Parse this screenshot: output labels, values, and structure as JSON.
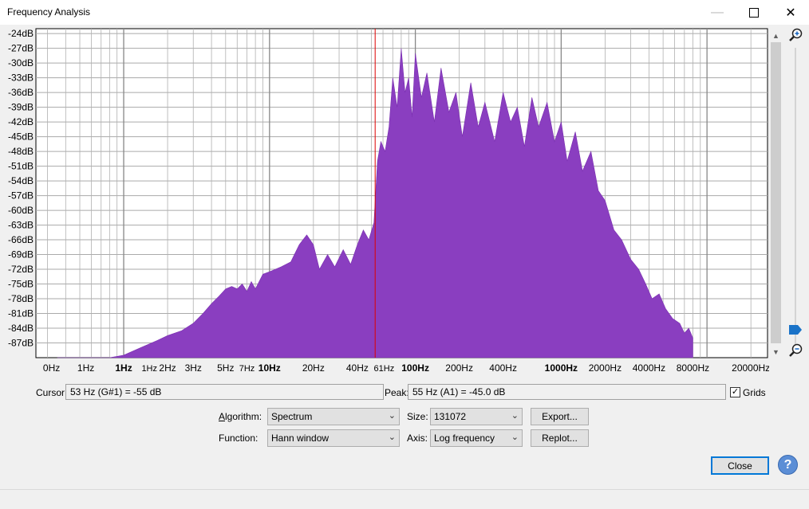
{
  "window": {
    "title": "Frequency Analysis",
    "controls": [
      "minimize-icon",
      "maximize-icon",
      "close-icon"
    ]
  },
  "chart_data": {
    "type": "area",
    "title": "",
    "xlabel": "",
    "ylabel": "",
    "x_scale": "log",
    "y_unit": "dB",
    "ylim": [
      -90,
      -23
    ],
    "grid": true,
    "colors": {
      "fill": "#8a3ec0",
      "grid": "#aaaaaa",
      "cursor_line": "#dd0000",
      "background": "#ffffff"
    },
    "y_ticks": [
      "-24dB",
      "-27dB",
      "-30dB",
      "-33dB",
      "-36dB",
      "-39dB",
      "-42dB",
      "-45dB",
      "-48dB",
      "-51dB",
      "-54dB",
      "-57dB",
      "-60dB",
      "-63dB",
      "-66dB",
      "-69dB",
      "-72dB",
      "-75dB",
      "-78dB",
      "-81dB",
      "-84dB",
      "-87dB"
    ],
    "x_ticks": [
      "0Hz",
      "1Hz",
      "1Hz",
      "1Hz",
      "2Hz",
      "3Hz",
      "5Hz",
      "7Hz",
      "10Hz",
      "20Hz",
      "40Hz",
      "61Hz",
      "100Hz",
      "200Hz",
      "400Hz",
      "1000Hz",
      "2000Hz",
      "4000Hz",
      "8000Hz",
      "20000Hz"
    ],
    "cursor_frequency_hz": 53,
    "series": [
      {
        "x": [
          0.35,
          0.45,
          0.6,
          0.8,
          1.0,
          1.3,
          1.7,
          2.0,
          2.5,
          3.0,
          3.5,
          4.0,
          4.5,
          5.0,
          5.5,
          6.0,
          6.5,
          7.0,
          7.5,
          8.0,
          9.0,
          10,
          12,
          14,
          16,
          18,
          20,
          22,
          25,
          28,
          32,
          36,
          40,
          44,
          48,
          52,
          55,
          58,
          62,
          66,
          70,
          75,
          80,
          85,
          90,
          95,
          100,
          110,
          120,
          135,
          150,
          170,
          190,
          210,
          240,
          270,
          300,
          350,
          400,
          450,
          500,
          560,
          630,
          700,
          800,
          900,
          1000,
          1100,
          1250,
          1400,
          1600,
          1800,
          2000,
          2300,
          2600,
          3000,
          3400,
          3800,
          4200,
          4700,
          5200,
          5800,
          6500,
          7000,
          7500,
          8000
        ],
        "y": [
          -90,
          -90,
          -90,
          -90,
          -89.5,
          -88,
          -86.5,
          -85.5,
          -84.5,
          -83,
          -81,
          -79,
          -77.5,
          -76,
          -75.5,
          -76,
          -75,
          -76.5,
          -74.5,
          -76,
          -73,
          -72.5,
          -71.5,
          -70.5,
          -67,
          -65,
          -67,
          -72,
          -69,
          -71.5,
          -68,
          -71,
          -67,
          -64,
          -66,
          -62.5,
          -50,
          -46,
          -48,
          -43,
          -33,
          -39,
          -27,
          -36,
          -33,
          -41,
          -28,
          -37,
          -32,
          -42,
          -31,
          -40,
          -36,
          -45,
          -34,
          -43,
          -38,
          -46,
          -36,
          -42,
          -39,
          -47,
          -37,
          -43,
          -38,
          -46,
          -42,
          -50,
          -44,
          -52,
          -48,
          -56,
          -58,
          -64,
          -66,
          -70,
          -72,
          -75,
          -78,
          -77,
          -80,
          -82,
          -83,
          -85,
          -84,
          -86
        ]
      }
    ]
  },
  "cursor": {
    "label": "Cursor:",
    "value": "53 Hz (G#1) = -55 dB"
  },
  "peak": {
    "label": "Peak:",
    "value": "55 Hz (A1) = -45.0 dB"
  },
  "grids": {
    "label": "Grids",
    "checked": true
  },
  "algorithm": {
    "label": "Algorithm:",
    "value": "Spectrum"
  },
  "size": {
    "label": "Size:",
    "value": "131072"
  },
  "function": {
    "label": "Function:",
    "value": "Hann window"
  },
  "axis": {
    "label": "Axis:",
    "value": "Log frequency"
  },
  "buttons": {
    "export": "Export...",
    "replot": "Replot...",
    "close": "Close"
  },
  "icons": {
    "zoom_in": "zoom-in-icon",
    "zoom_out": "zoom-out-icon",
    "help": "help-icon"
  }
}
